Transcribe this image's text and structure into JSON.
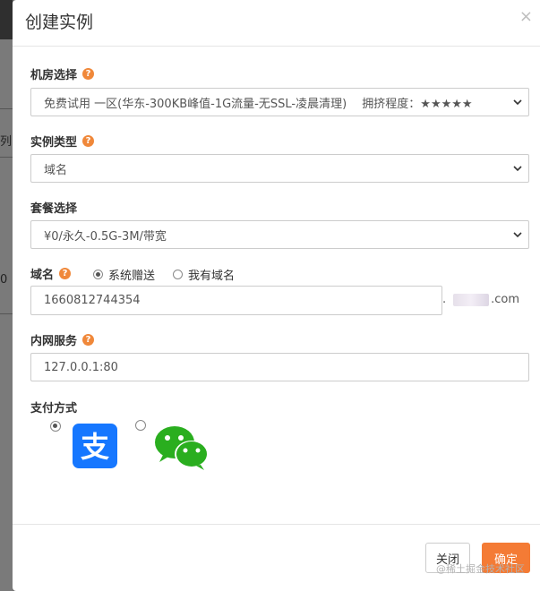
{
  "backdrop": {
    "text_a": "列",
    "text_b": "0"
  },
  "modal": {
    "title": "创建实例",
    "close": "×"
  },
  "room": {
    "label": "机房选择",
    "selected": "免费试用 一区(华东-300KB峰值-1G流量-无SSL-凌晨清理)　 拥挤程度：★★★★★"
  },
  "instance_type": {
    "label": "实例类型",
    "selected": "域名"
  },
  "plan": {
    "label": "套餐选择",
    "selected": "¥0/永久-0.5G-3M/带宽"
  },
  "domain": {
    "label": "域名",
    "option_system": "系统赠送",
    "option_own": "我有域名",
    "value": "1660812744354",
    "suffix_dot": ".",
    "suffix_tld": ".com"
  },
  "intranet": {
    "label": "内网服务",
    "value": "127.0.0.1:80"
  },
  "payment": {
    "label": "支付方式",
    "alipay_glyph": "支"
  },
  "footer": {
    "close_label": "关闭",
    "ok_label": "确定"
  },
  "watermark": "@稀土掘金技术社区",
  "colors": {
    "accent": "#f47b35",
    "help_icon": "#f0883a",
    "alipay": "#1677ff",
    "wechat": "#2aae1f"
  }
}
